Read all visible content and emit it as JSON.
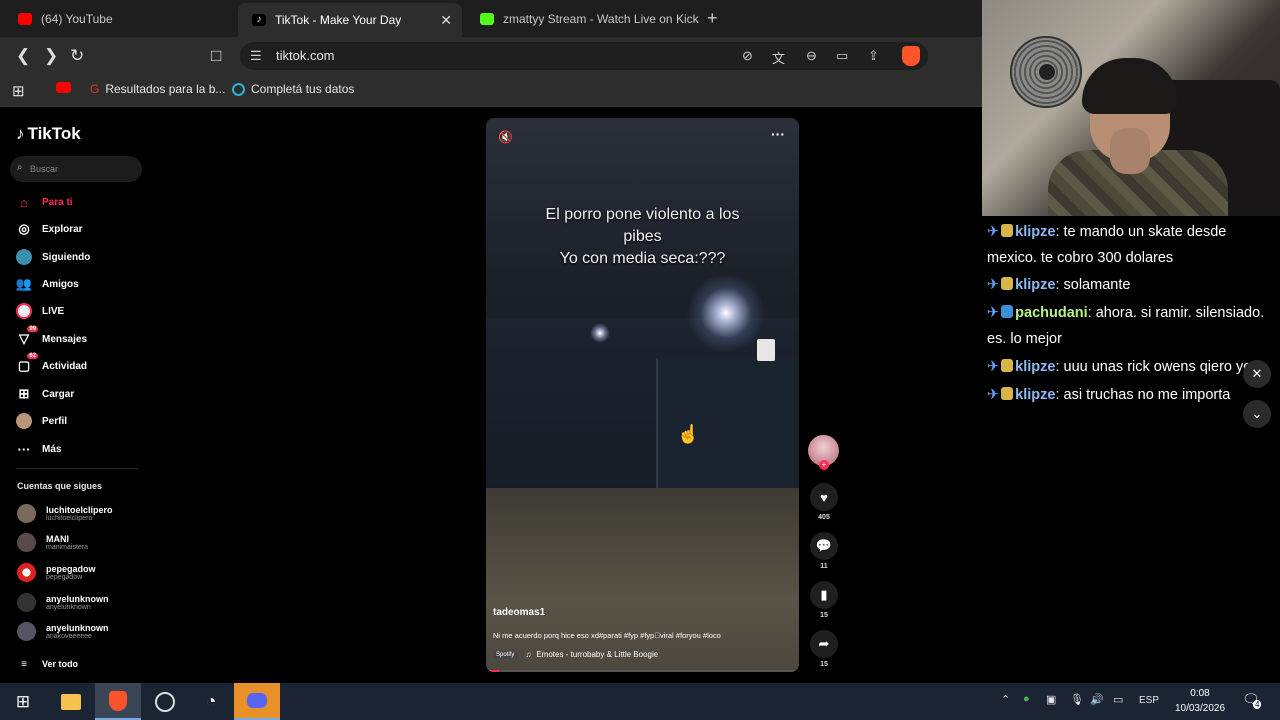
{
  "browser": {
    "tabs": [
      {
        "title": "(64) YouTube",
        "color": "#ff0000"
      },
      {
        "title": "TikTok - Make Your Day",
        "color": "#ffffff"
      },
      {
        "title": "zmattyy Stream - Watch Live on Kick",
        "color": "#53fc18"
      }
    ],
    "url": "tiktok.com",
    "bookmarks": [
      {
        "label": "Resultados para la b..."
      },
      {
        "label": "Completá tus datos"
      }
    ]
  },
  "tiktok": {
    "brand": "TikTok",
    "search_placeholder": "Buscar",
    "nav": [
      {
        "label": "Para ti",
        "icon": "home-icon"
      },
      {
        "label": "Explorar",
        "icon": "compass-icon"
      },
      {
        "label": "Siguiendo",
        "icon": "following-icon"
      },
      {
        "label": "Amigos",
        "icon": "friends-icon"
      },
      {
        "label": "LIVE",
        "icon": "live-icon"
      },
      {
        "label": "Mensajes",
        "icon": "messages-icon",
        "badge": "99"
      },
      {
        "label": "Actividad",
        "icon": "activity-icon",
        "badge": "62"
      },
      {
        "label": "Cargar",
        "icon": "upload-icon"
      },
      {
        "label": "Perfil",
        "icon": "profile-icon"
      },
      {
        "label": "Más",
        "icon": "more-icon"
      }
    ],
    "following_header": "Cuentas que sigues",
    "following": [
      {
        "name": "luchitoelclipero",
        "handle": "luchitoelclipero"
      },
      {
        "name": "MANI",
        "handle": "manimaistera"
      },
      {
        "name": "pepegadow",
        "handle": "pepegadow"
      },
      {
        "name": "anyelunknown",
        "handle": "anyelunknown"
      },
      {
        "name": "anyelunknown",
        "handle": "anakoveeeeee"
      }
    ],
    "see_all": "Ver todo",
    "video": {
      "caption_line1": "El porro pone violento a los",
      "caption_line2": "pibes",
      "caption_line3": "Yo con media seca:???",
      "author": "tadeomas1",
      "description": "Ni me acuerdo porq hice eso xd#parati #fyp #fyp゚viral #foryou #loco",
      "spotify_tag": "Spotify",
      "music": "Emotes - turrobaby & Little Boogie",
      "progress": 0.04
    },
    "actions": {
      "likes": "405",
      "comments": "11",
      "saves": "15",
      "shares": "15"
    }
  },
  "chat": {
    "messages": [
      {
        "user": "klipze",
        "text": ": te mando un skate desde mexico. te cobro 300 dolares",
        "style": "u1"
      },
      {
        "user": "klipze",
        "text": ": solamante",
        "style": "u1"
      },
      {
        "user": "pachudani",
        "text": ": ahora. si ramir. silensiado. es. lo mejor",
        "style": "u2"
      },
      {
        "user": "klipze",
        "text": ": uuu unas rick owens qiero yo",
        "style": "u1"
      },
      {
        "user": "klipze",
        "text": ": asi truchas no me importa",
        "style": "u1"
      }
    ]
  },
  "taskbar": {
    "language": "ESP",
    "time": "0:08",
    "date": "10/03/2026",
    "notifications": "4"
  }
}
